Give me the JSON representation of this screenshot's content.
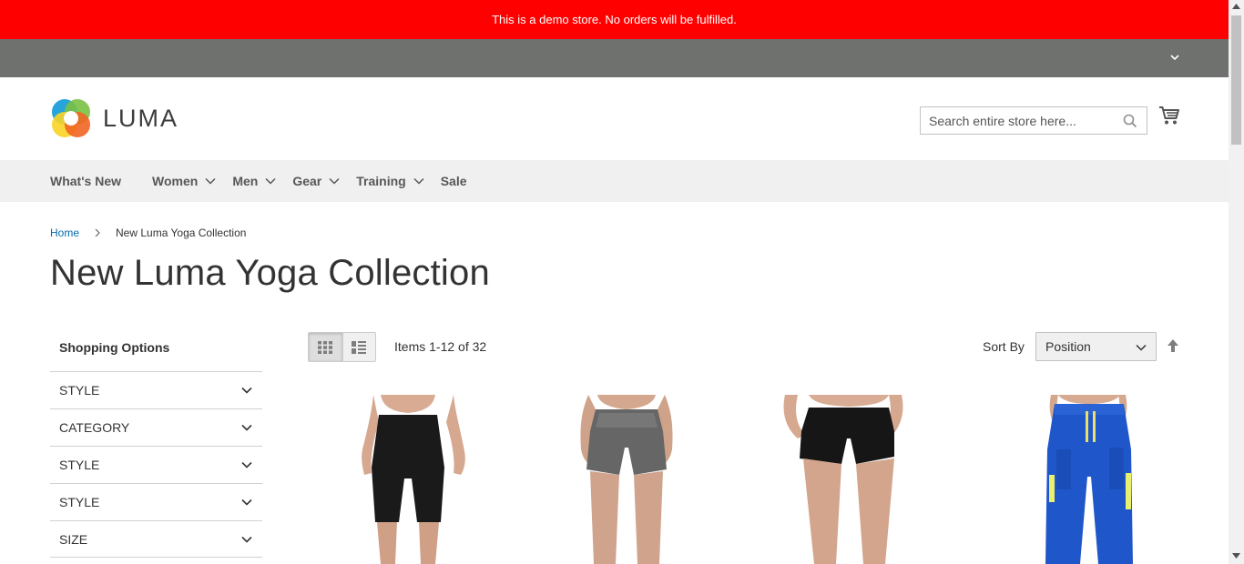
{
  "notice": {
    "text": "This is a demo store. No orders will be fulfilled."
  },
  "header": {
    "logo_text": "LUMA",
    "search": {
      "placeholder": "Search entire store here..."
    }
  },
  "nav": {
    "items": [
      {
        "label": "What's New"
      },
      {
        "label": "Women"
      },
      {
        "label": "Men"
      },
      {
        "label": "Gear"
      },
      {
        "label": "Training"
      },
      {
        "label": "Sale"
      }
    ]
  },
  "breadcrumbs": {
    "home": "Home",
    "current": "New Luma Yoga Collection"
  },
  "page_title": "New Luma Yoga Collection",
  "sidebar": {
    "title": "Shopping Options",
    "filters": [
      {
        "label": "STYLE"
      },
      {
        "label": "CATEGORY"
      },
      {
        "label": "STYLE"
      },
      {
        "label": "STYLE"
      },
      {
        "label": "SIZE"
      }
    ]
  },
  "toolbar": {
    "items_count": "Items 1-12 of 32",
    "sort_label": "Sort By",
    "sort_value": "Position"
  },
  "colors": {
    "notice_bg": "#ff0000",
    "panel_bg": "#6e716e",
    "nav_bg": "#f0f0f0",
    "link": "#006bb4"
  },
  "products": [
    {
      "image": "black-bike-shorts"
    },
    {
      "image": "grey-heather-shorts"
    },
    {
      "image": "black-running-shorts"
    },
    {
      "image": "blue-cargo-pants"
    }
  ]
}
